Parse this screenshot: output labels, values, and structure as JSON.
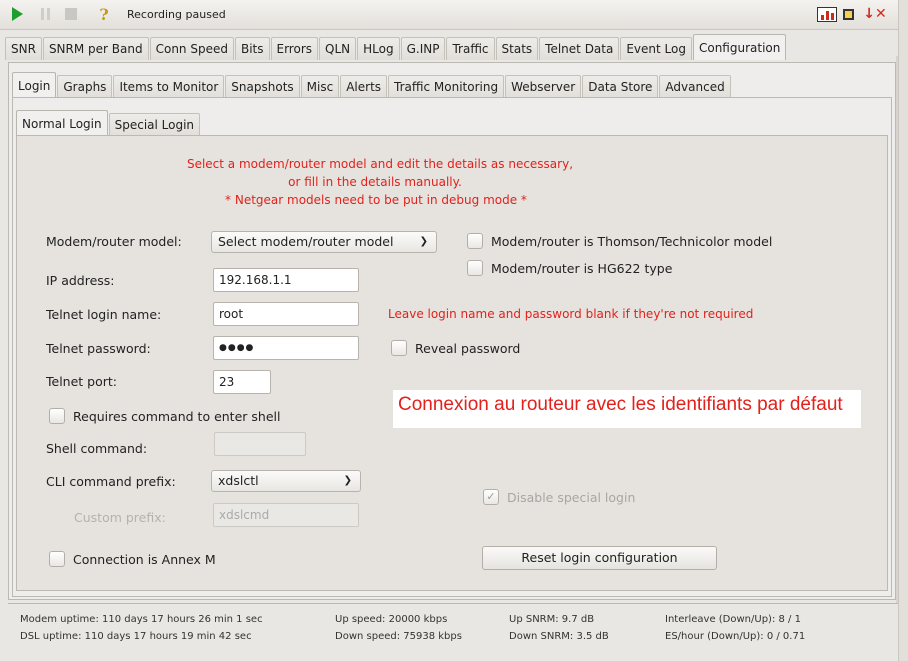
{
  "toolbar": {
    "play_icon": "play-icon",
    "pause_icon": "pause-icon",
    "stop_icon": "stop-icon",
    "help_icon": "help-icon",
    "status": "Recording paused"
  },
  "main_tabs": [
    "SNR",
    "SNRM per Band",
    "Conn Speed",
    "Bits",
    "Errors",
    "QLN",
    "HLog",
    "G.INP",
    "Traffic",
    "Stats",
    "Telnet Data",
    "Event Log",
    "Configuration"
  ],
  "config_tabs": [
    "Login",
    "Graphs",
    "Items to Monitor",
    "Snapshots",
    "Misc",
    "Alerts",
    "Traffic Monitoring",
    "Webserver",
    "Data Store",
    "Advanced"
  ],
  "login_tabs": [
    "Normal Login",
    "Special Login"
  ],
  "instructions": {
    "line1": "Select a modem/router model and edit the details as necessary,",
    "line2": "or fill in the details manually.",
    "line3": "* Netgear models need to be put in debug mode *"
  },
  "form": {
    "model_label": "Modem/router model:",
    "model_value": "Select modem/router model",
    "thomson_label": "Modem/router is Thomson/Technicolor model",
    "hg622_label": "Modem/router is HG622 type",
    "ip_label": "IP address:",
    "ip_value": "192.168.1.1",
    "login_label": "Telnet login name:",
    "login_value": "root",
    "login_hint": "Leave login name and password blank if they're not required",
    "password_label": "Telnet password:",
    "password_value": "●●●●",
    "reveal_label": "Reveal password",
    "port_label": "Telnet port:",
    "port_value": "23",
    "requires_shell_label": "Requires command to enter shell",
    "shell_label": "Shell command:",
    "shell_value": "",
    "cli_label": "CLI command prefix:",
    "cli_value": "xdslctl",
    "custom_label": "Custom prefix:",
    "custom_value": "xdslcmd",
    "disable_special_label": "Disable special login",
    "annex_label": "Connection is Annex M",
    "reset_label": "Reset login configuration"
  },
  "annotation": "Connexion au routeur avec les identifiants par défaut",
  "status": {
    "modem_uptime": "Modem uptime: 110 days 17 hours 26 min 1 sec",
    "dsl_uptime": "DSL uptime: 110 days 17 hours 19 min 42 sec",
    "up_speed": "Up speed: 20000 kbps",
    "down_speed": "Down speed: 75938 kbps",
    "up_snrm": "Up SNRM: 9.7 dB",
    "down_snrm": "Down SNRM: 3.5 dB",
    "interleave": "Interleave (Down/Up): 8 / 1",
    "es_hour": "ES/hour (Down/Up): 0 / 0.71"
  }
}
